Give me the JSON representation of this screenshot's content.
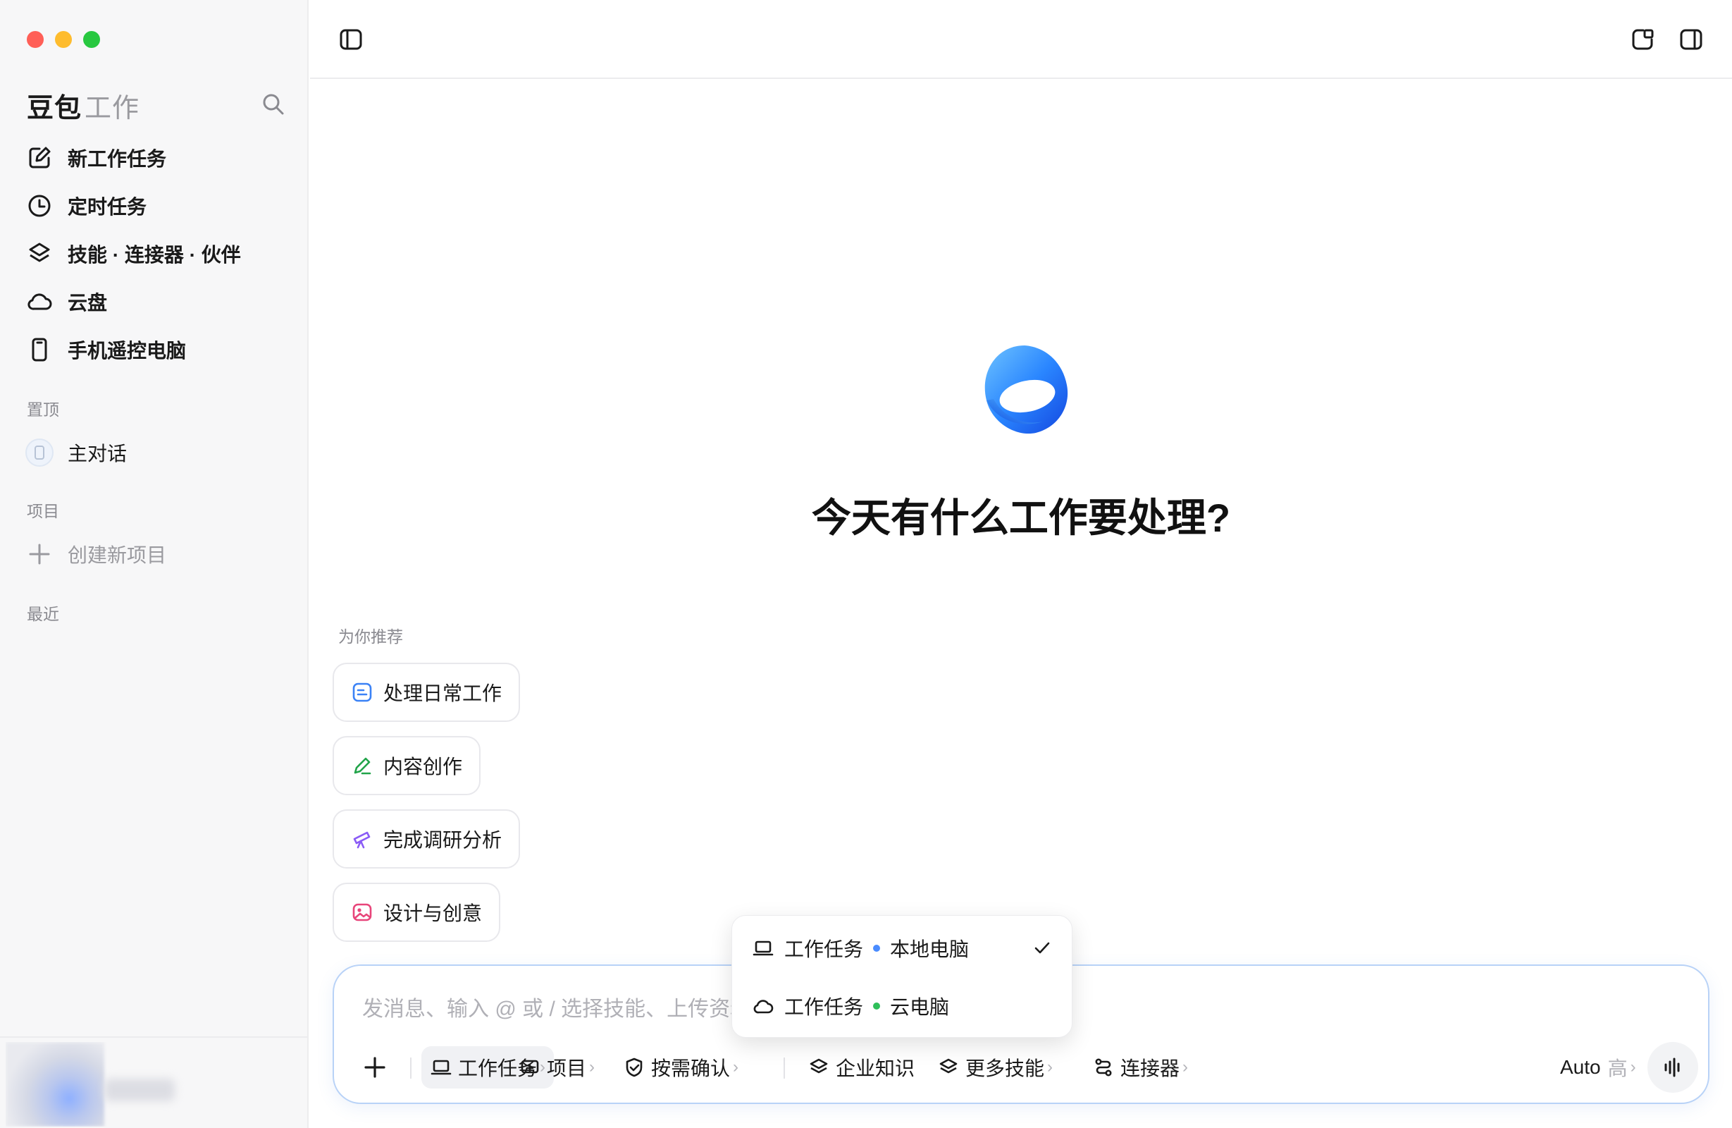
{
  "sidebar": {
    "brand_main": "豆包",
    "brand_sub": "工作",
    "nav": [
      {
        "label": "新工作任务",
        "icon": "edit-icon"
      },
      {
        "label": "定时任务",
        "icon": "clock-icon"
      },
      {
        "label": "技能 · 连接器 · 伙伴",
        "icon": "layers-icon"
      },
      {
        "label": "云盘",
        "icon": "cloud-icon"
      },
      {
        "label": "手机遥控电脑",
        "icon": "phone-icon"
      }
    ],
    "pinned_title": "置顶",
    "pinned_item": "主对话",
    "projects_title": "项目",
    "create_project": "创建新项目",
    "recent_title": "最近"
  },
  "main": {
    "headline": "今天有什么工作要处理?",
    "recommend_title": "为你推荐",
    "chips": [
      {
        "label": "处理日常工作",
        "icon": "list-icon",
        "color": "#3b82f6"
      },
      {
        "label": "内容创作",
        "icon": "pen-icon",
        "color": "#22a44a"
      },
      {
        "label": "完成调研分析",
        "icon": "telescope-icon",
        "color": "#8b5cf6"
      },
      {
        "label": "设计与创意",
        "icon": "image-icon",
        "color": "#e8457a"
      }
    ]
  },
  "composer": {
    "placeholder": "发消息、输入 @ 或 / 选择技能、上传资料",
    "tools": {
      "task": "工作任务",
      "project": "项目",
      "confirm": "按需确认",
      "knowledge": "企业知识",
      "skills": "更多技能",
      "connector": "连接器"
    },
    "model": "Auto",
    "effort": "高"
  },
  "dropdown": {
    "items": [
      {
        "label": "工作任务",
        "sub": "本地电脑",
        "dot_color": "#4a8cff",
        "icon": "laptop-icon",
        "selected": true
      },
      {
        "label": "工作任务",
        "sub": "云电脑",
        "dot_color": "#2fbf5a",
        "icon": "cloud-icon",
        "selected": false
      }
    ]
  }
}
